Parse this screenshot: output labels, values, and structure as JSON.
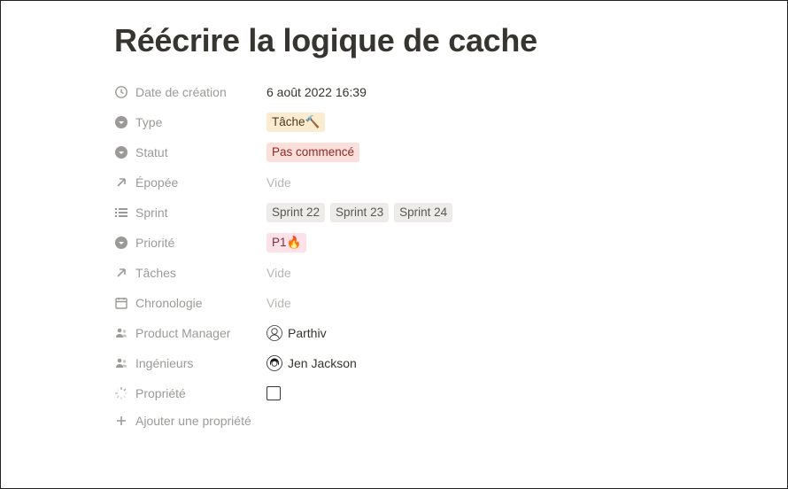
{
  "title": "Réécrire la logique de cache",
  "props": {
    "created": {
      "label": "Date de création",
      "value": "6 août 2022 16:39"
    },
    "type": {
      "label": "Type",
      "tag": "Tâche🔨"
    },
    "status": {
      "label": "Statut",
      "tag": "Pas commencé"
    },
    "epic": {
      "label": "Épopée",
      "empty": "Vide"
    },
    "sprint": {
      "label": "Sprint",
      "tags": [
        "Sprint 22",
        "Sprint 23",
        "Sprint 24"
      ]
    },
    "priority": {
      "label": "Priorité",
      "tag": "P1🔥"
    },
    "tasks": {
      "label": "Tâches",
      "empty": "Vide"
    },
    "timeline": {
      "label": "Chronologie",
      "empty": "Vide"
    },
    "pm": {
      "label": "Product Manager",
      "person": "Parthiv"
    },
    "eng": {
      "label": "Ingénieurs",
      "person": "Jen Jackson"
    },
    "custom": {
      "label": "Propriété"
    }
  },
  "add_property": "Ajouter une propriété"
}
